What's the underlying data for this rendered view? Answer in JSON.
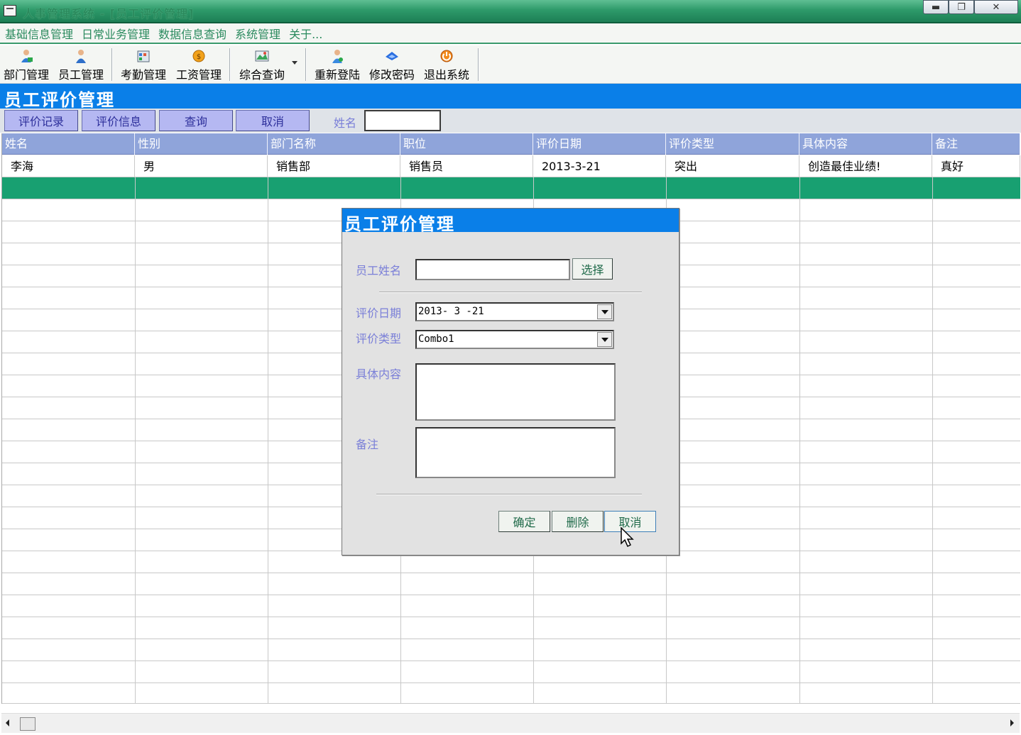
{
  "window": {
    "title": "人事管理系统 - [员工评价管理]"
  },
  "menu": [
    "基础信息管理",
    "日常业务管理",
    "数据信息查询",
    "系统管理",
    "关于..."
  ],
  "toolbar": [
    {
      "label": "部门管理",
      "icon": "department-icon"
    },
    {
      "label": "员工管理",
      "icon": "employee-icon"
    },
    {
      "label": "考勤管理",
      "icon": "attendance-icon"
    },
    {
      "label": "工资管理",
      "icon": "salary-icon"
    },
    {
      "label": "综合查询",
      "icon": "query-icon"
    },
    {
      "label": "重新登陆",
      "icon": "relogin-icon"
    },
    {
      "label": "修改密码",
      "icon": "password-icon"
    },
    {
      "label": "退出系统",
      "icon": "exit-icon"
    }
  ],
  "section": {
    "title": "员工评价管理"
  },
  "commands": {
    "buttons": [
      "评价记录",
      "评价信息",
      "查询",
      "取消"
    ],
    "name_label": "姓名",
    "name_value": ""
  },
  "grid": {
    "columns": [
      "姓名",
      "性别",
      "部门名称",
      "职位",
      "评价日期",
      "评价类型",
      "具体内容",
      "备注"
    ],
    "rows": [
      [
        "李海",
        "男",
        "销售部",
        "销售员",
        "2013-3-21",
        "突出",
        "创造最佳业绩!",
        "真好"
      ]
    ],
    "selected_row": 1
  },
  "dialog": {
    "title": "员工评价管理",
    "employee_name_label": "员工姓名",
    "employee_name_value": "",
    "select_button": "选择",
    "date_label": "评价日期",
    "date_value": "2013- 3 -21",
    "type_label": "评价类型",
    "type_value": "Combo1",
    "content_label": "具体内容",
    "content_value": "",
    "remark_label": "备注",
    "remark_value": "",
    "ok_button": "确定",
    "delete_button": "删除",
    "cancel_button": "取消"
  },
  "colors": {
    "title_green": "#2e9a6a",
    "section_blue": "#0a7fe8",
    "header_blue": "#8fa4da",
    "selection_green": "#18a071",
    "command_purple": "#b5b8f2"
  }
}
